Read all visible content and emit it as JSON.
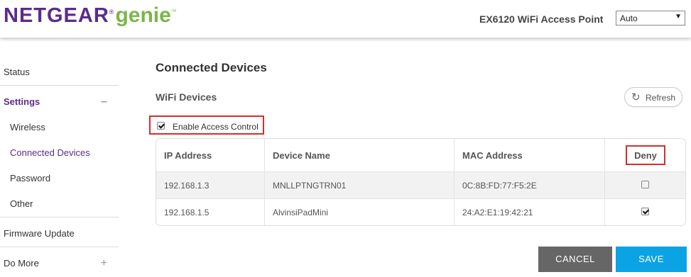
{
  "brand": {
    "name": "NETGEAR",
    "product": "genie",
    "reg_mark": "®",
    "tm_mark": "™"
  },
  "header": {
    "device_title": "EX6120 WiFi Access Point",
    "mode_select": {
      "value": "Auto",
      "arrow": "▼"
    }
  },
  "sidebar": {
    "items": [
      {
        "label": "Status"
      },
      {
        "label": "Settings",
        "toggle": "–"
      },
      {
        "label": "Wireless"
      },
      {
        "label": "Connected Devices"
      },
      {
        "label": "Password"
      },
      {
        "label": "Other"
      },
      {
        "label": "Firmware Update"
      },
      {
        "label": "Do More",
        "toggle": "+"
      }
    ]
  },
  "main": {
    "title": "Connected Devices",
    "section": "WiFi Devices",
    "refresh": {
      "label": "Refresh",
      "icon": "refresh-icon",
      "glyph": "↻"
    },
    "access_control": {
      "label": "Enable Access Control",
      "checked": true
    },
    "table": {
      "columns": [
        "IP Address",
        "Device Name",
        "MAC Address",
        "Deny"
      ],
      "rows": [
        {
          "ip": "192.168.1.3",
          "name": "MNLLPTNGTRN01",
          "mac": "0C:8B:FD:77:F5:2E",
          "deny": false
        },
        {
          "ip": "192.168.1.5",
          "name": "AlvinsiPadMini",
          "mac": "24:A2:E1:19:42:21",
          "deny": true
        }
      ]
    },
    "buttons": {
      "cancel": "CANCEL",
      "save": "SAVE"
    }
  },
  "colors": {
    "brand_purple": "#5b2c8a",
    "brand_green": "#7ab648",
    "highlight_red": "#d32f2f",
    "save_blue": "#0ba3e4",
    "cancel_gray": "#666666"
  }
}
